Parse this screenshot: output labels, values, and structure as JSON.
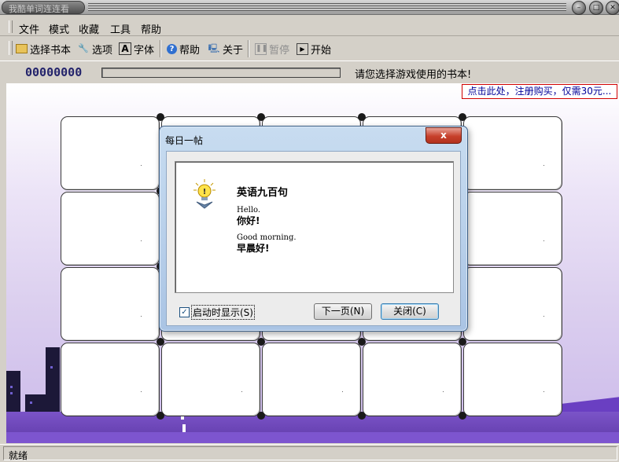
{
  "window": {
    "title": "我酷单词连连看"
  },
  "menu": [
    "文件",
    "模式",
    "收藏",
    "工具",
    "帮助"
  ],
  "toolbar": {
    "select_book": "选择书本",
    "options": "选项",
    "font": "字体",
    "help": "帮助",
    "about": "关于",
    "pause": "暂停",
    "start": "开始"
  },
  "score": "00000000",
  "progress": 0,
  "hint": "请您选择游戏使用的书本!",
  "buy_link": "点击此处，注册购买，仅需30元...",
  "dialog": {
    "title": "每日一帖",
    "close": "x",
    "heading": "英语九百句",
    "lines": [
      {
        "en": "Hello.",
        "zh": "你好!"
      },
      {
        "en": "Good morning.",
        "zh": "早晨好!"
      }
    ],
    "show_on_start": "启动时显示(S)",
    "show_on_start_checked": true,
    "next_button": "下一页(N)",
    "close_button": "关闭(C)"
  },
  "status": "就绪",
  "colors": {
    "score": "#23236b",
    "link": "#000099",
    "link_border": "#d00000"
  }
}
